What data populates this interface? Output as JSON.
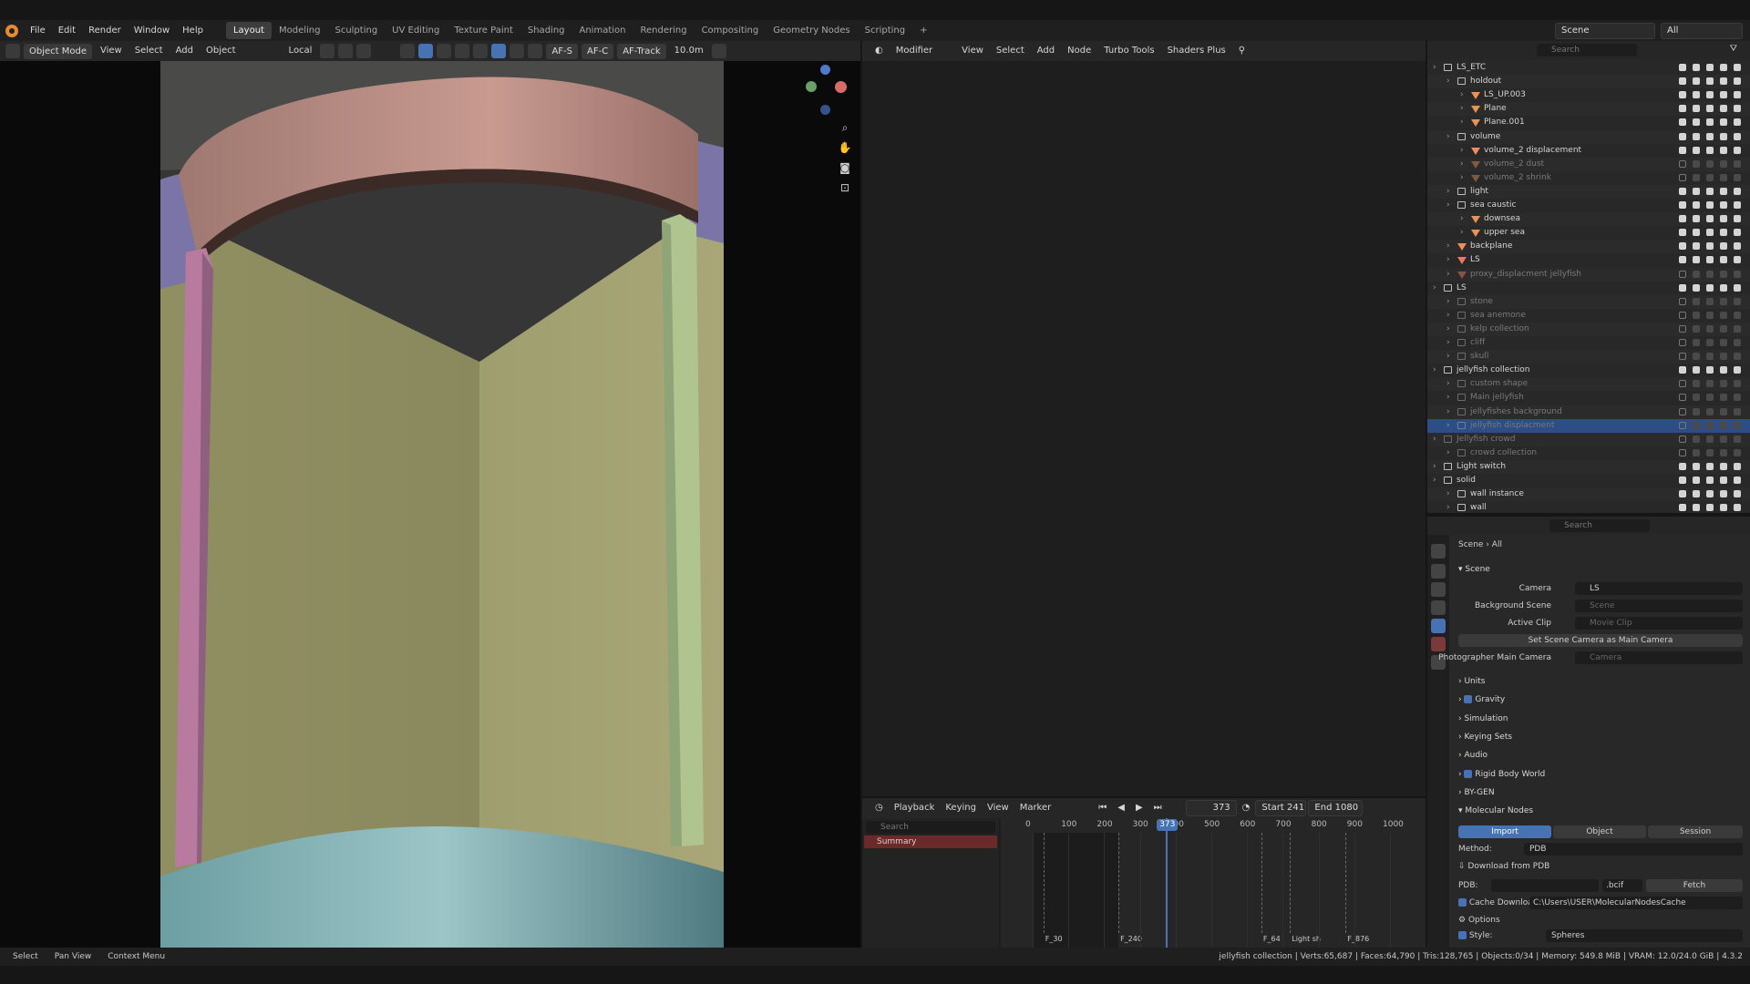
{
  "menu": [
    "File",
    "Edit",
    "Render",
    "Window",
    "Help"
  ],
  "workspaces": [
    "Layout",
    "Modeling",
    "Sculpting",
    "UV Editing",
    "Texture Paint",
    "Shading",
    "Animation",
    "Rendering",
    "Compositing",
    "Geometry Nodes",
    "Scripting"
  ],
  "active_workspace": "Layout",
  "scene_label": "Scene",
  "viewlayer_label": "All",
  "viewport_header": {
    "mode": "Object Mode",
    "items": [
      "View",
      "Select",
      "Add",
      "Object"
    ],
    "transform": "Local",
    "af_s": "AF-S",
    "af_c": "AF-C",
    "af_track": "AF-Track",
    "distance": "10.0m"
  },
  "node_header": {
    "editor": "Modifier",
    "items": [
      "View",
      "Select",
      "Add",
      "Node",
      "Turbo Tools",
      "Shaders Plus"
    ]
  },
  "timeline": {
    "items": [
      "Playback",
      "Keying",
      "View",
      "Marker"
    ],
    "current": "373",
    "start_label": "Start",
    "start": "241",
    "end_label": "End",
    "end": "1080",
    "search_placeholder": "Search",
    "summary": "Summary",
    "ticks": [
      "0",
      "100",
      "200",
      "300",
      "400",
      "500",
      "600",
      "700",
      "800",
      "900",
      "1000"
    ],
    "markers": [
      "F_30",
      "F_240",
      "F_64",
      "Light sh",
      "F_876"
    ]
  },
  "outliner": {
    "search_placeholder": "Search",
    "rows": [
      {
        "indent": 0,
        "label": "LS_ETC",
        "kind": "coll",
        "dim": false
      },
      {
        "indent": 1,
        "label": "holdout",
        "kind": "coll",
        "dim": false
      },
      {
        "indent": 2,
        "label": "LS_UP.003",
        "kind": "obj",
        "dim": false
      },
      {
        "indent": 2,
        "label": "Plane",
        "kind": "obj",
        "dim": false
      },
      {
        "indent": 2,
        "label": "Plane.001",
        "kind": "obj",
        "dim": false
      },
      {
        "indent": 1,
        "label": "volume",
        "kind": "coll",
        "dim": false
      },
      {
        "indent": 2,
        "label": "volume_2 displacement",
        "kind": "obj",
        "dim": false
      },
      {
        "indent": 2,
        "label": "volume_2 dust",
        "kind": "obj",
        "dim": true
      },
      {
        "indent": 2,
        "label": "volume_2 shrink",
        "kind": "obj",
        "dim": true
      },
      {
        "indent": 1,
        "label": "light",
        "kind": "coll",
        "dim": false
      },
      {
        "indent": 1,
        "label": "sea caustic",
        "kind": "coll",
        "dim": false
      },
      {
        "indent": 2,
        "label": "downsea",
        "kind": "obj",
        "dim": false
      },
      {
        "indent": 2,
        "label": "upper sea",
        "kind": "obj",
        "dim": false
      },
      {
        "indent": 1,
        "label": "backplane",
        "kind": "obj",
        "dim": false
      },
      {
        "indent": 1,
        "label": "LS",
        "kind": "cam",
        "dim": false
      },
      {
        "indent": 1,
        "label": "proxy_displacment jellyfish",
        "kind": "obj",
        "dim": true
      },
      {
        "indent": 0,
        "label": "LS",
        "kind": "coll",
        "dim": false
      },
      {
        "indent": 1,
        "label": "stone",
        "kind": "coll",
        "dim": true
      },
      {
        "indent": 1,
        "label": "sea anemone",
        "kind": "coll",
        "dim": true
      },
      {
        "indent": 1,
        "label": "kelp collection",
        "kind": "coll",
        "dim": true
      },
      {
        "indent": 1,
        "label": "cliff",
        "kind": "coll",
        "dim": true
      },
      {
        "indent": 1,
        "label": "skull",
        "kind": "coll",
        "dim": true
      },
      {
        "indent": 0,
        "label": "jellyfish collection",
        "kind": "coll",
        "dim": false
      },
      {
        "indent": 1,
        "label": "custom shape",
        "kind": "coll",
        "dim": true
      },
      {
        "indent": 1,
        "label": "Main jellyfish",
        "kind": "coll",
        "dim": true
      },
      {
        "indent": 1,
        "label": "jellyfishes background",
        "kind": "coll",
        "dim": true
      },
      {
        "indent": 1,
        "label": "jellyfish displacment",
        "kind": "coll",
        "dim": true,
        "selected": true
      },
      {
        "indent": 0,
        "label": "Jellyfish crowd",
        "kind": "coll",
        "dim": true
      },
      {
        "indent": 1,
        "label": "crowd collection",
        "kind": "coll",
        "dim": true
      },
      {
        "indent": 0,
        "label": "Light switch",
        "kind": "coll",
        "dim": false
      },
      {
        "indent": 0,
        "label": "solid",
        "kind": "coll",
        "dim": false
      },
      {
        "indent": 1,
        "label": "wall instance",
        "kind": "coll",
        "dim": false
      },
      {
        "indent": 1,
        "label": "wall",
        "kind": "coll",
        "dim": false
      }
    ]
  },
  "properties": {
    "search_placeholder": "Search",
    "breadcrumb": [
      "Scene",
      "All"
    ],
    "scene_section": "Scene",
    "camera_label": "Camera",
    "camera_value": "LS",
    "bg_scene_label": "Background Scene",
    "bg_scene_placeholder": "Scene",
    "active_clip_label": "Active Clip",
    "active_clip_placeholder": "Movie Clip",
    "set_camera_button": "Set Scene Camera as Main Camera",
    "photographer_label": "Photographer Main Camera",
    "photographer_placeholder": "Camera",
    "panels": [
      "Units",
      "Gravity",
      "Simulation",
      "Keying Sets",
      "Audio",
      "Rigid Body World",
      "BY-GEN",
      "Molecular Nodes"
    ],
    "mn_tabs": [
      "Import",
      "Object",
      "Session"
    ],
    "method_label": "Method:",
    "method_value": "PDB",
    "download_label": "Download from PDB",
    "pdb_label": "PDB:",
    "format_value": ".bcif",
    "fetch_button": "Fetch",
    "cache_label": "Cache Downloads",
    "cache_path": "C:\\Users\\USER\\MolecularNodesCache",
    "options_label": "Options",
    "style_label": "Style:",
    "style_value": "Spheres"
  },
  "status": {
    "left": [
      "Select",
      "Pan View",
      "Context Menu"
    ],
    "right": "jellyfish collection | Verts:65,687 | Faces:64,790 | Tris:128,765 | Objects:0/34 | Memory: 549.8 MiB | VRAM: 12.0/24.0 GiB | 4.3.2"
  },
  "colors": {
    "accent": "#4772b3",
    "selection": "#2d4d85",
    "playhead": "#4772b3",
    "blender_orange": "#e88a2f"
  }
}
